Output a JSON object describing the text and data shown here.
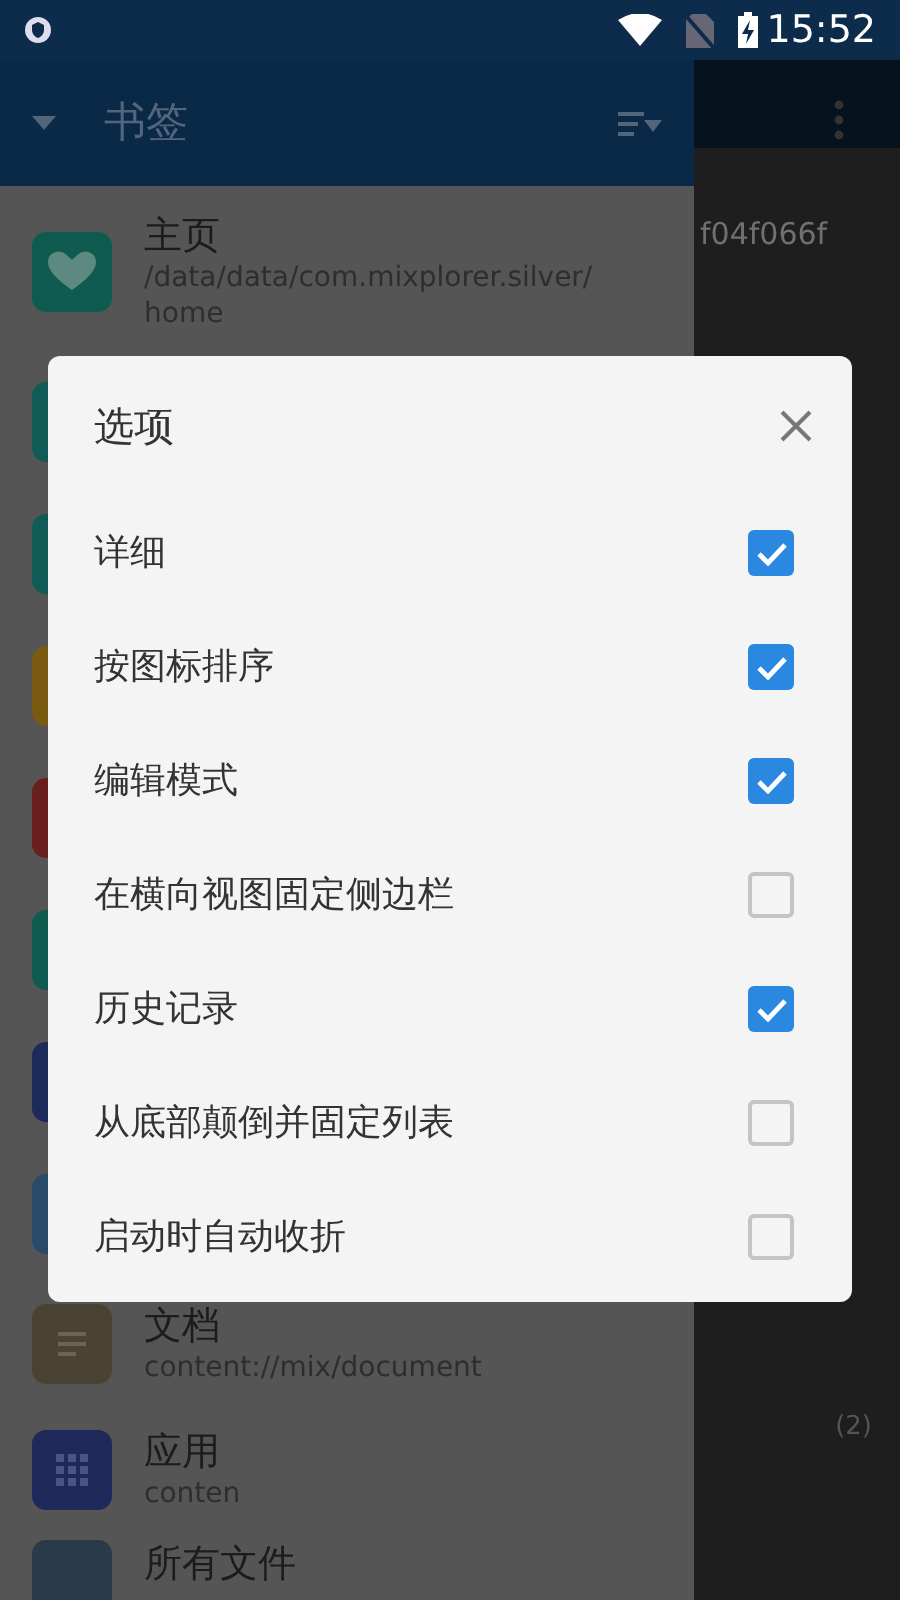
{
  "status_bar": {
    "time": "15:52"
  },
  "drawer": {
    "title": "书签",
    "items": [
      {
        "kind": "heart",
        "title": "主页",
        "subtitle": "/data/data/com.mixplorer.silver/home",
        "color": "#0f5b4f"
      },
      {
        "kind": "blank",
        "color": "#0f5b55"
      },
      {
        "kind": "blank",
        "color": "#0f5b55"
      },
      {
        "kind": "blank",
        "color": "#7a5a10"
      },
      {
        "kind": "blank",
        "color": "#6a1f1f"
      },
      {
        "kind": "blank",
        "color": "#0f5b4f"
      },
      {
        "kind": "blank",
        "color": "#1c2a5c"
      },
      {
        "kind": "blank",
        "color": "#2a4a6a"
      },
      {
        "kind": "lines",
        "title": "文档",
        "subtitle": "content://mix/document",
        "color": "#4a4232"
      },
      {
        "kind": "grid",
        "title": "应用",
        "subtitle": "conten",
        "color": "#1e2a5a"
      },
      {
        "kind": "blank",
        "title": "所有文件",
        "color": "#2a3a4a"
      }
    ]
  },
  "main_panel": {
    "header_text": "f04f066f",
    "count": "(2)"
  },
  "dialog": {
    "title": "选项",
    "options": [
      {
        "label": "详细",
        "checked": true
      },
      {
        "label": "按图标排序",
        "checked": true
      },
      {
        "label": "编辑模式",
        "checked": true
      },
      {
        "label": "在横向视图固定侧边栏",
        "checked": false
      },
      {
        "label": "历史记录",
        "checked": true
      },
      {
        "label": "从底部颠倒并固定列表",
        "checked": false
      },
      {
        "label": "启动时自动收折",
        "checked": false
      }
    ]
  }
}
